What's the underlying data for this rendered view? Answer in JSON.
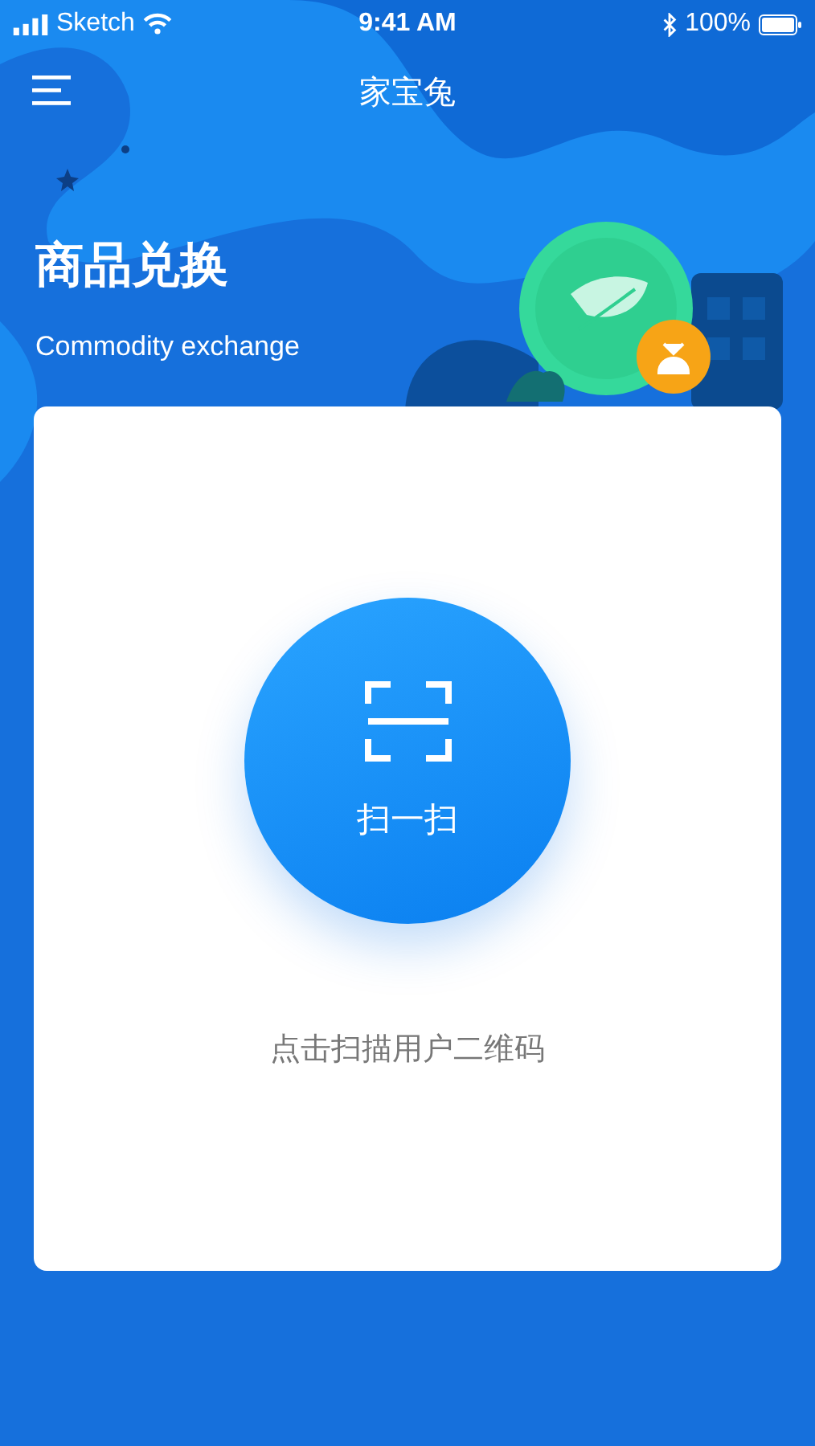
{
  "status_bar": {
    "carrier": "Sketch",
    "time": "9:41 AM",
    "battery": "100%"
  },
  "nav": {
    "title": "家宝兔"
  },
  "hero": {
    "title": "商品兑换",
    "subtitle": "Commodity exchange"
  },
  "scan": {
    "label": "扫一扫",
    "hint": "点击扫描用户二维码"
  }
}
